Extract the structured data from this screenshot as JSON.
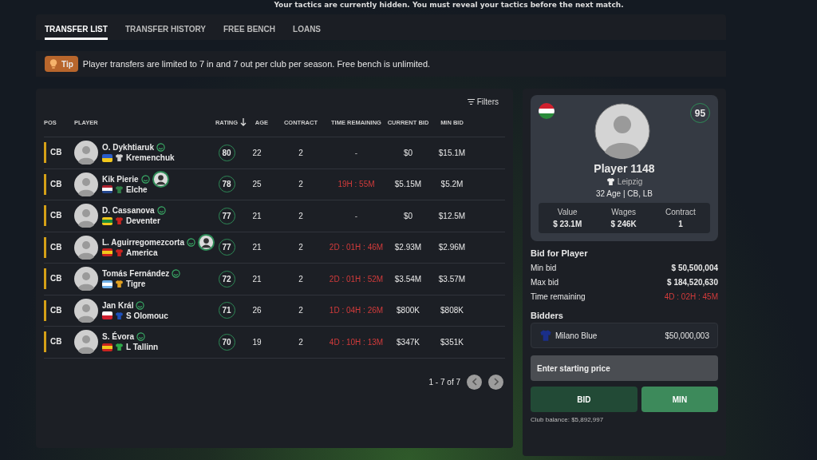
{
  "banner": "Your tactics are currently hidden. You must reveal your tactics before the next match.",
  "tabs": [
    {
      "label": "TRANSFER LIST",
      "selected": true
    },
    {
      "label": "TRANSFER HISTORY",
      "selected": false
    },
    {
      "label": "FREE BENCH",
      "selected": false
    },
    {
      "label": "LOANS",
      "selected": false
    }
  ],
  "tip": {
    "label": "Tip",
    "text": "Player transfers are limited to 7 in and 7 out per club per season. Free bench is unlimited."
  },
  "table": {
    "filters": "Filters",
    "columns": [
      {
        "label": "POS",
        "sorted": false
      },
      {
        "label": "PLAYER",
        "sorted": false
      },
      {
        "label": "RATING",
        "sorted": true
      },
      {
        "label": "AGE",
        "sorted": false
      },
      {
        "label": "CONTRACT",
        "sorted": false
      },
      {
        "label": "TIME REMAINING",
        "sorted": false
      },
      {
        "label": "CURRENT BID",
        "sorted": false
      },
      {
        "label": "MIN BID",
        "sorted": false
      }
    ],
    "rows": [
      {
        "pos": "CB",
        "name": "O. Dykhtiaruk",
        "portrait_badge": false,
        "flag": [
          {
            "color": "#2a5cc8"
          },
          {
            "color": "#f2c81c"
          }
        ],
        "kit": {
          "color": "#cfcfcf"
        },
        "club": "Kremenchuk",
        "rating": "80",
        "age": "22",
        "contract": "2",
        "time": "-",
        "running": false,
        "current_bid": "$0",
        "min_bid": "$15.1M"
      },
      {
        "pos": "CB",
        "name": "Kik Pierie",
        "portrait_badge": true,
        "flag": [
          {
            "color": "#b0222e"
          },
          {
            "color": "#ffffff"
          },
          {
            "color": "#24468c"
          }
        ],
        "kit": {
          "color": "#2f7d46"
        },
        "club": "Elche",
        "rating": "78",
        "age": "25",
        "contract": "2",
        "time": "19H : 55M",
        "running": true,
        "current_bid": "$5.15M",
        "min_bid": "$5.2M"
      },
      {
        "pos": "CB",
        "name": "D. Cassanova",
        "portrait_badge": false,
        "flag": [
          {
            "color": "#f2c81c"
          },
          {
            "color": "#1a8a3a"
          },
          {
            "color": "#f2c81c"
          }
        ],
        "kit": {
          "color": "#c8231f"
        },
        "club": "Deventer",
        "rating": "77",
        "age": "21",
        "contract": "2",
        "time": "-",
        "running": false,
        "current_bid": "$0",
        "min_bid": "$12.5M"
      },
      {
        "pos": "CB",
        "name": "L. Aguirregomezcorta",
        "portrait_badge": true,
        "flag": [
          {
            "color": "#c8231f"
          },
          {
            "color": "#f2c81c"
          },
          {
            "color": "#c8231f"
          }
        ],
        "kit": {
          "color": "#c8231f"
        },
        "club": "America",
        "rating": "77",
        "age": "21",
        "contract": "2",
        "time": "2D : 01H : 46M",
        "running": true,
        "current_bid": "$2.93M",
        "min_bid": "$2.96M"
      },
      {
        "pos": "CB",
        "name": "Tomás Fernández",
        "portrait_badge": false,
        "flag": [
          {
            "color": "#6fb0e8"
          },
          {
            "color": "#ffffff"
          },
          {
            "color": "#6fb0e8"
          }
        ],
        "kit": {
          "color": "#e0a020"
        },
        "club": "Tigre",
        "rating": "72",
        "age": "21",
        "contract": "2",
        "time": "2D : 01H : 52M",
        "running": true,
        "current_bid": "$3.54M",
        "min_bid": "$3.57M"
      },
      {
        "pos": "CB",
        "name": "Jan Král",
        "portrait_badge": false,
        "flag": [
          {
            "color": "#ffffff"
          },
          {
            "color": "#d0202e"
          }
        ],
        "kit": {
          "color": "#1d4fb8"
        },
        "club": "S Olomouc",
        "rating": "71",
        "age": "26",
        "contract": "2",
        "time": "1D : 04H : 26M",
        "running": true,
        "current_bid": "$800K",
        "min_bid": "$808K"
      },
      {
        "pos": "CB",
        "name": "S. Évora",
        "portrait_badge": false,
        "flag": [
          {
            "color": "#c8231f"
          },
          {
            "color": "#f2c81c"
          },
          {
            "color": "#c8231f"
          }
        ],
        "kit": {
          "color": "#2fa84a"
        },
        "club": "L Tallinn",
        "rating": "70",
        "age": "19",
        "contract": "2",
        "time": "4D : 10H : 13M",
        "running": true,
        "current_bid": "$347K",
        "min_bid": "$351K"
      }
    ],
    "pagination": "1 - 7 of 7"
  },
  "player": {
    "flag": [
      {
        "color": "#d0202e"
      },
      {
        "color": "#ffffff"
      },
      {
        "color": "#2a8a3a"
      }
    ],
    "rating": "95",
    "name": "Player 1148",
    "kit": {
      "color": "#eeeeee"
    },
    "club": "Leipzig",
    "info": "32 Age | CB, LB",
    "stats": [
      {
        "label": "Value",
        "value": "$ 23.1M"
      },
      {
        "label": "Wages",
        "value": "$ 246K"
      },
      {
        "label": "Contract",
        "value": "1"
      }
    ]
  },
  "bid": {
    "title": "Bid for Player",
    "lines": [
      {
        "label": "Min bid",
        "value": "$ 50,500,004",
        "running": false
      },
      {
        "label": "Max bid",
        "value": "$ 184,520,630",
        "running": false
      },
      {
        "label": "Time remaining",
        "value": "4D : 02H : 45M",
        "running": true
      }
    ],
    "bidders_title": "Bidders",
    "bidders": [
      {
        "kit": {
          "color": "#1a2f8a"
        },
        "club": "Milano Blue",
        "amount": "$50,000,003"
      }
    ],
    "placeholder": "Enter starting price",
    "bid_button": "BID",
    "min_button": "MIN",
    "balance": "Club balance: $5,892,997"
  }
}
